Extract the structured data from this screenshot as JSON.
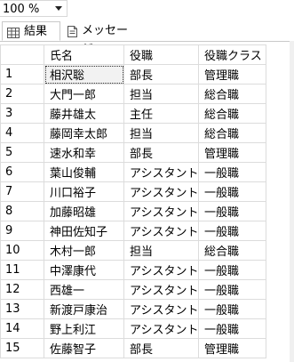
{
  "toolbar": {
    "zoom_value": "100 %"
  },
  "tabs": [
    {
      "label": "結果",
      "icon": "grid-icon"
    },
    {
      "label": "メッセージ",
      "icon": "message-icon"
    }
  ],
  "grid": {
    "headers": [
      "",
      "氏名",
      "役職",
      "役職クラス"
    ],
    "rows": [
      [
        "1",
        "相沢聡",
        "部長",
        "管理職"
      ],
      [
        "2",
        "大門一郎",
        "担当",
        "総合職"
      ],
      [
        "3",
        "藤井雄太",
        "主任",
        "総合職"
      ],
      [
        "4",
        "藤岡幸太郎",
        "担当",
        "総合職"
      ],
      [
        "5",
        "速水和幸",
        "部長",
        "管理職"
      ],
      [
        "6",
        "葉山俊輔",
        "アシスタント",
        "一般職"
      ],
      [
        "7",
        "川口裕子",
        "アシスタント",
        "一般職"
      ],
      [
        "8",
        "加藤昭雄",
        "アシスタント",
        "一般職"
      ],
      [
        "9",
        "神田佐知子",
        "アシスタント",
        "一般職"
      ],
      [
        "10",
        "木村一郎",
        "担当",
        "総合職"
      ],
      [
        "11",
        "中澤康代",
        "アシスタント",
        "一般職"
      ],
      [
        "12",
        "西雄一",
        "アシスタント",
        "一般職"
      ],
      [
        "13",
        "新渡戸康治",
        "アシスタント",
        "一般職"
      ],
      [
        "14",
        "野上利江",
        "アシスタント",
        "一般職"
      ],
      [
        "15",
        "佐藤智子",
        "部長",
        "管理職"
      ]
    ]
  }
}
